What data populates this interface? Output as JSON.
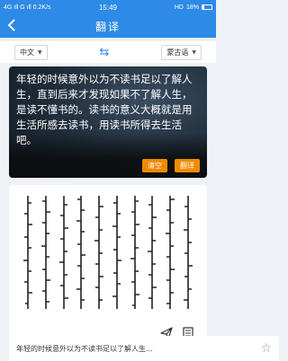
{
  "status": {
    "left": "4G ıll  G ıll  0.2K/s",
    "time": "15:49",
    "right": "HD",
    "battery": "18%"
  },
  "header": {
    "title": "翻译",
    "back_icon": "back-arrow-icon"
  },
  "languages": {
    "source": "中文",
    "target": "蒙古语",
    "swap_icon": "swap-arrows-icon"
  },
  "source": {
    "text": "年轻的时候意外以为不读书足以了解人生，直到后来才发现如果不了解人生，是读不懂书的。读书的意义大概就是用生活所感去读书，用读书所得去生活吧。",
    "clear_label": "清空",
    "translate_label": "翻译"
  },
  "result": {
    "send_icon": "send-icon",
    "copy_icon": "document-icon"
  },
  "history": {
    "text": "年轻的时候意外以为不读书足以了解人生...",
    "star_icon": "star-icon"
  },
  "colors": {
    "primary": "#2d8ae6",
    "accent": "#f08a00"
  }
}
